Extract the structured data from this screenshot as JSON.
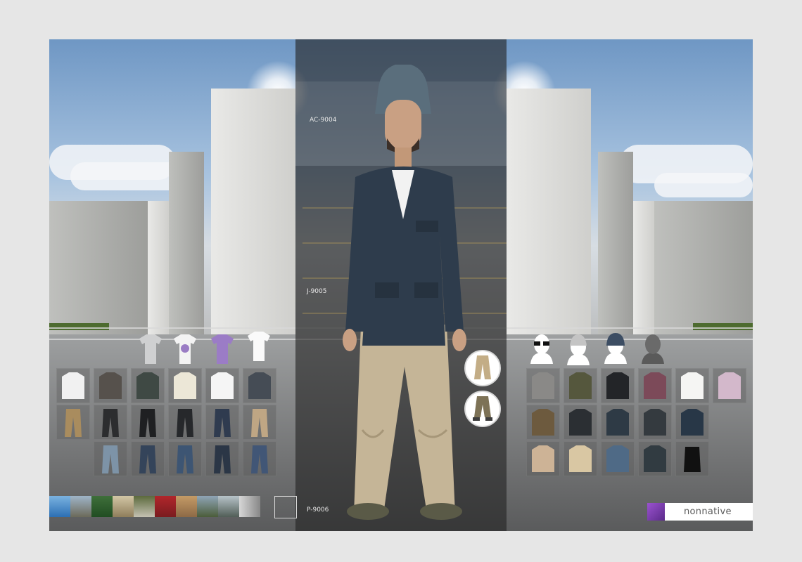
{
  "outfit": {
    "hat_code": "AC-9004",
    "jacket_code": "J-9005",
    "pants_code": "P-9006"
  },
  "brand": {
    "name": "nonnative",
    "swatch_color": "#7a3fb0"
  },
  "left_panel": {
    "tops_row": [
      "light-grey-logo-tee",
      "white-print-tee",
      "purple-print-tee",
      "white-v-neck-tee"
    ],
    "shirts_row": [
      "white-longsleeve",
      "dark-check-shirt",
      "dark-green-longsleeve",
      "cream-longsleeve",
      "white-longsleeve",
      "charcoal-shirt"
    ],
    "pants_row_1": [
      "khaki-pants",
      "black-pants",
      "black-pants",
      "black-pants",
      "navy-jeans",
      "khaki-pants"
    ],
    "pants_row_2": [
      "light-wash-jeans",
      "dark-jeans",
      "mid-jeans",
      "dark-jeans",
      "dark-jeans"
    ]
  },
  "right_panel": {
    "accessories_row": [
      "sunglasses-icon",
      "grey-beanie-icon",
      "navy-knit-cap-icon",
      "bald-head-icon"
    ],
    "row_1": [
      "grey-polo",
      "olive-knit",
      "black-longsleeve",
      "burgundy-henley",
      "white-longsleeve",
      "pink-cardigan"
    ],
    "row_2": [
      "brown-jacket",
      "black-jacket",
      "navy-jacket",
      "charcoal-jacket",
      "navy-blazer"
    ],
    "row_3": [
      "tan-jacket",
      "beige-jacket",
      "denim-jacket",
      "dark-jacket",
      "black-vest"
    ]
  },
  "pants_options": [
    "khaki-pants-full",
    "olive-pants-rolled"
  ],
  "backgrounds": [
    "sea",
    "mountains",
    "forest",
    "park-sign",
    "gate",
    "red-door",
    "building",
    "street",
    "boats",
    "grey-gradient"
  ]
}
